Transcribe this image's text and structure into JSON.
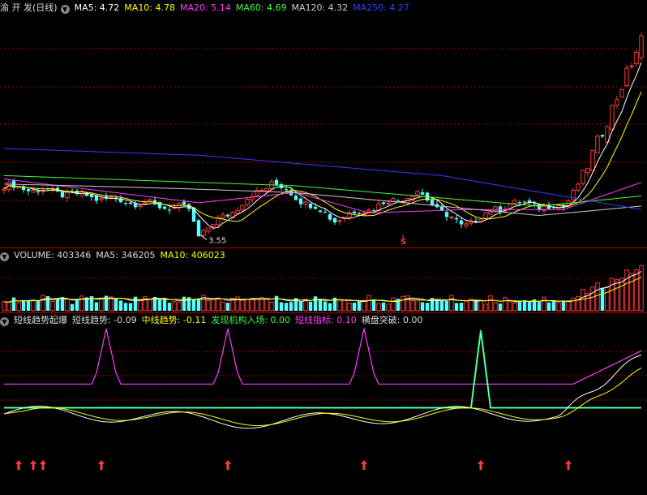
{
  "colors": {
    "background": "#000000",
    "grid": "#b00000",
    "up": "#ff3b3b",
    "down": "#54ffff",
    "white": "#ffffff",
    "yellow": "#ffff00",
    "magenta": "#ff3cff",
    "green": "#3cff3c",
    "ma120": "#cccccc",
    "blue": "#3b3bff",
    "label": "#dddddd"
  },
  "price_panel": {
    "title": "渝 开 发(日线)",
    "ma_labels": [
      {
        "name": "MA5:",
        "value": "4.72",
        "color": "#ffffff"
      },
      {
        "name": "MA10:",
        "value": "4.78",
        "color": "#ffff00"
      },
      {
        "name": "MA20:",
        "value": "5.14",
        "color": "#ff3cff"
      },
      {
        "name": "MA60:",
        "value": "4.69",
        "color": "#3cff3c"
      },
      {
        "name": "MA120:",
        "value": "4.32",
        "color": "#cccccc"
      },
      {
        "name": "MA250:",
        "value": "4.27",
        "color": "#3b3bff"
      }
    ],
    "low_annotation": "3.55",
    "signal_mark": "S"
  },
  "volume_panel": {
    "labels": [
      {
        "name": "VOLUME:",
        "value": "403346",
        "color": "#dddddd"
      },
      {
        "name": "MA5:",
        "value": "346205",
        "color": "#dddddd"
      },
      {
        "name": "MA10:",
        "value": "406023",
        "color": "#ffff00"
      }
    ]
  },
  "indicator_panel": {
    "labels": [
      {
        "name": "短线趋势起爆",
        "value": "",
        "color": "#dddddd"
      },
      {
        "name": "短线趋势:",
        "value": "-0.09",
        "color": "#dddddd"
      },
      {
        "name": "中线趋势:",
        "value": "-0.11",
        "color": "#ffff00"
      },
      {
        "name": "发现机构入场:",
        "value": "0.00",
        "color": "#3cff3c"
      },
      {
        "name": "短线指标:",
        "value": "0.10",
        "color": "#ff3cff"
      },
      {
        "name": "横盘突破:",
        "value": "0.00",
        "color": "#dddddd"
      }
    ]
  },
  "chart_data": [
    {
      "type": "candlestick",
      "x_count": 132,
      "y_range": [
        3.3,
        10.0
      ],
      "grid": true,
      "key_points": [
        {
          "index": 0,
          "close": 5.0
        },
        {
          "index": 38,
          "close": 4.3
        },
        {
          "index": 40,
          "close": 3.55
        },
        {
          "index": 55,
          "close": 5.1
        },
        {
          "index": 68,
          "close": 4.0
        },
        {
          "index": 85,
          "close": 4.8
        },
        {
          "index": 94,
          "close": 3.8
        },
        {
          "index": 104,
          "close": 4.5
        },
        {
          "index": 115,
          "close": 4.35
        },
        {
          "index": 120,
          "close": 5.6
        },
        {
          "index": 131,
          "close": 9.3
        }
      ],
      "ma_key_points": {
        "MA250": [
          [
            0,
            6.1
          ],
          [
            40,
            5.9
          ],
          [
            90,
            5.3
          ],
          [
            131,
            4.3
          ]
        ],
        "MA60": [
          [
            0,
            5.3
          ],
          [
            60,
            5.0
          ],
          [
            110,
            4.4
          ],
          [
            131,
            4.7
          ]
        ],
        "MA20": [
          [
            0,
            5.2
          ],
          [
            40,
            4.5
          ],
          [
            60,
            4.8
          ],
          [
            75,
            4.2
          ],
          [
            95,
            4.3
          ],
          [
            115,
            4.3
          ],
          [
            131,
            5.1
          ]
        ]
      }
    },
    {
      "type": "bar",
      "series_name": "VOLUME",
      "y_range": [
        0,
        900000
      ],
      "last_value": 403346
    },
    {
      "type": "line",
      "y_range": [
        -1,
        1
      ],
      "pulse_peaks_x": [
        21,
        46,
        74
      ],
      "green_spike_x": 98,
      "arrow_x": [
        3,
        6,
        8,
        20,
        46,
        74,
        98,
        116
      ]
    }
  ]
}
